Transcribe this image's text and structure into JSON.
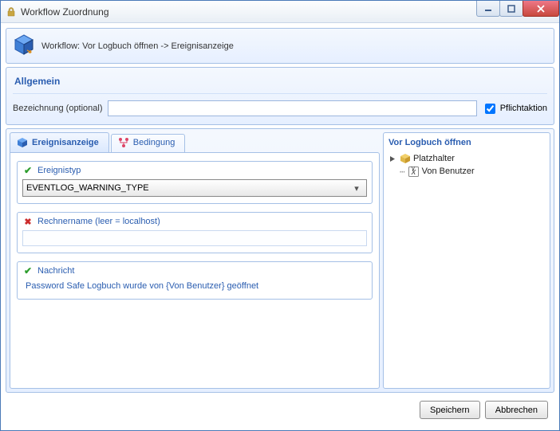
{
  "window": {
    "title": "Workflow Zuordnung"
  },
  "header": {
    "workflow_label": "Workflow: Vor Logbuch öffnen -> Ereignisanzeige"
  },
  "general": {
    "section_title": "Allgemein",
    "name_label": "Bezeichnung (optional)",
    "name_value": "",
    "mandatory_label": "Pflichtaktion",
    "mandatory_checked": true
  },
  "tabs": {
    "event": {
      "label": "Ereignisanzeige"
    },
    "condition": {
      "label": "Bedingung"
    }
  },
  "event_panel": {
    "type_label": "Ereignistyp",
    "type_value": "EVENTLOG_WARNING_TYPE",
    "host_label": "Rechnername (leer = localhost)",
    "host_value": "",
    "message_label": "Nachricht",
    "message_value": "Password Safe Logbuch wurde von {Von Benutzer} geöffnet"
  },
  "sidebar": {
    "title": "Vor Logbuch öffnen",
    "nodes": {
      "root": "Platzhalter",
      "child": "Von Benutzer"
    }
  },
  "buttons": {
    "save": "Speichern",
    "cancel": "Abbrechen"
  }
}
